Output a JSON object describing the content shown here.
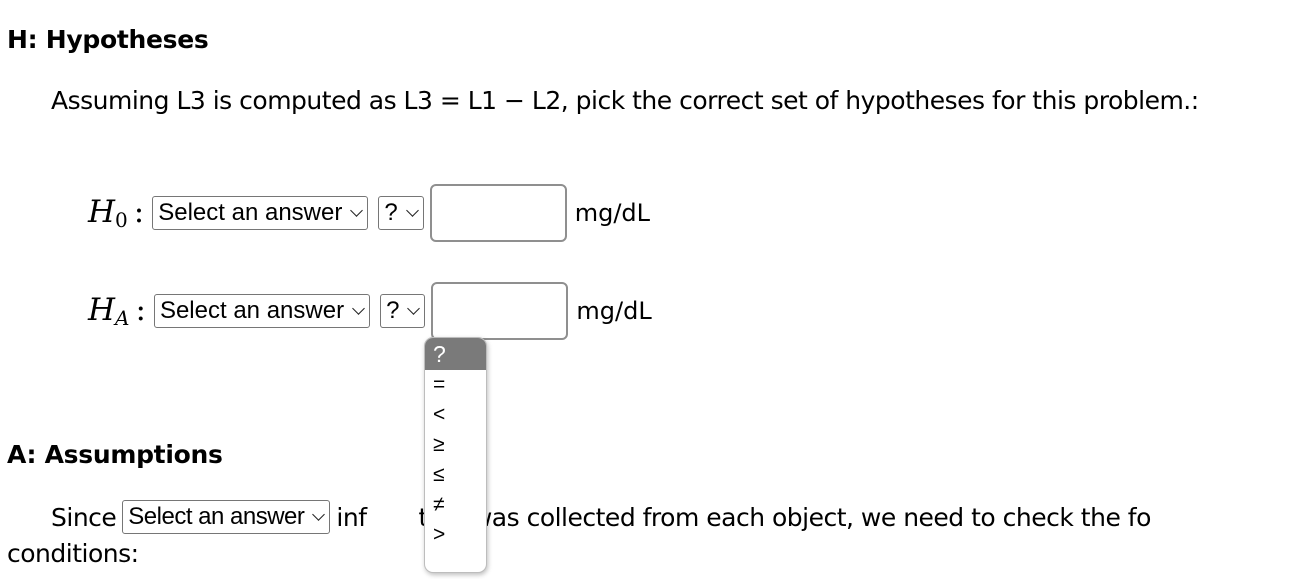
{
  "sections": {
    "hypotheses": {
      "heading": "H: Hypotheses",
      "prompt": "Assuming L3 is computed as L3 = L1 − L2, pick the correct set of hypotheses for this problem.:",
      "rows": [
        {
          "symbol": "H",
          "subscript": "0",
          "colon": ":",
          "parameter_select": "Select an answer",
          "operator_select": "?",
          "value_input": "",
          "unit": "mg/dL"
        },
        {
          "symbol": "H",
          "subscript": "A",
          "colon": ":",
          "parameter_select": "Select an answer",
          "operator_select": "?",
          "value_input": "",
          "unit": "mg/dL"
        }
      ]
    },
    "assumptions": {
      "heading": "A: Assumptions",
      "text_before": "Since",
      "select": "Select an answer",
      "text_after_visible": "inf",
      "text_after_hidden_tail": "tion was collected from each object, we need to check the fo",
      "line2": "conditions:"
    }
  },
  "operator_dropdown": {
    "open": true,
    "selected": "?",
    "options": [
      "?",
      "=",
      "<",
      "≥",
      "≤",
      "≠",
      ">"
    ]
  }
}
